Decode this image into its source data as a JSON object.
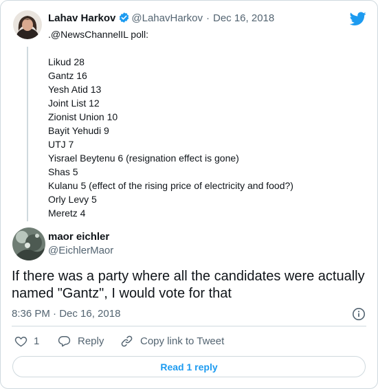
{
  "parent_tweet": {
    "author_name": "Lahav Harkov",
    "author_handle": "@LahavHarkov",
    "separator": "·",
    "date": "Dec 16, 2018",
    "intro": ".@NewsChannelIL poll:",
    "lines": [
      "Likud 28",
      "Gantz 16",
      "Yesh Atid 13",
      "Joint List 12",
      "Zionist Union 10",
      "Bayit Yehudi 9",
      "UTJ 7",
      "Yisrael Beytenu 6 (resignation effect is gone)",
      "Shas 5",
      "Kulanu 5 (effect of the rising price of electricity and food?)",
      "Orly Levy 5",
      "Meretz 4"
    ]
  },
  "main_tweet": {
    "author_name": "maor eichler",
    "author_handle": "@EichlerMaor",
    "text": "If there was a party where all the candidates were actually named \"Gantz\", I would vote for that",
    "timestamp": "8:36 PM · Dec 16, 2018"
  },
  "actions": {
    "like_count": "1",
    "reply_label": "Reply",
    "copy_link_label": "Copy link to Tweet"
  },
  "read_replies_label": "Read 1 reply",
  "icons": {
    "brand": "twitter-bird-icon",
    "verified": "verified-badge-icon",
    "info": "info-icon",
    "like": "heart-icon",
    "reply": "reply-bubble-icon",
    "link": "link-icon"
  },
  "colors": {
    "accent": "#1d9bf0",
    "text": "#0f1419",
    "muted": "#536471",
    "border": "#cfd9de"
  }
}
